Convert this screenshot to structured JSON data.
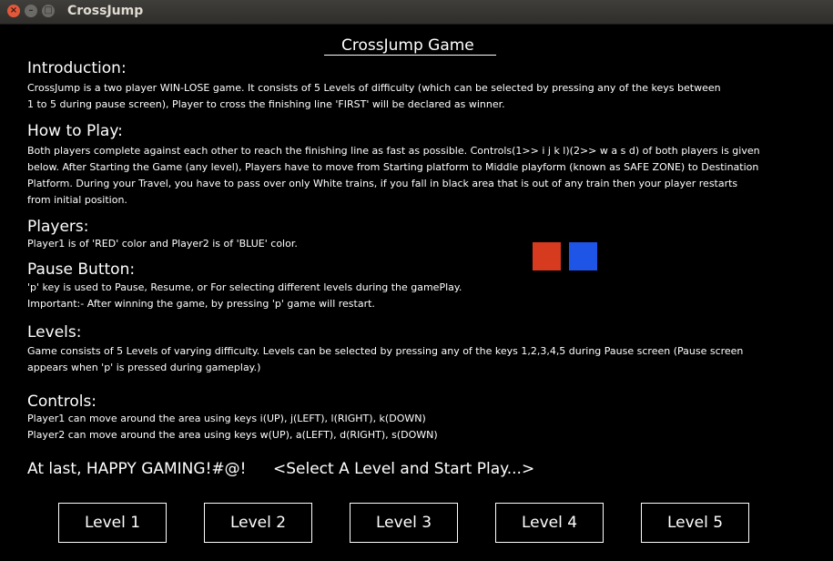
{
  "window": {
    "title": "CrossJump",
    "close_glyph": "×",
    "minimize_glyph": "–",
    "maximize_glyph": "□"
  },
  "game": {
    "title": "CrossJump Game",
    "sections": {
      "intro": {
        "heading": "Introduction:",
        "lines": [
          "CrossJump is a two player WIN-LOSE game. It consists of 5 Levels of difficulty (which can be selected by pressing any of the keys between",
          "1 to 5 during pause screen), Player to cross the finishing line 'FIRST' will be declared as winner."
        ]
      },
      "howto": {
        "heading": "How to Play:",
        "lines": [
          "Both players complete against each other to reach the finishing line as fast as possible. Controls(1>> i j k l)(2>> w a s d) of both players is given",
          "below. After Starting the Game (any level), Players have to move from Starting platform to Middle playform (known as SAFE ZONE) to Destination",
          "Platform. During your Travel, you have to pass over only White trains, if you fall in black area that is out of any train then your player restarts",
          "from initial position."
        ]
      },
      "players": {
        "heading": "Players:",
        "lines": [
          "Player1 is of 'RED' color and Player2 is of 'BLUE' color."
        ]
      },
      "pause": {
        "heading": "Pause Button:",
        "lines": [
          "'p' key is used to Pause, Resume, or For selecting different levels during the gamePlay.",
          "Important:- After winning the game, by pressing 'p' game will restart."
        ]
      },
      "levels": {
        "heading": "Levels:",
        "lines": [
          "Game consists of 5 Levels of varying difficulty. Levels can be selected by pressing any of the keys 1,2,3,4,5 during Pause screen (Pause screen",
          "appears when 'p' is pressed during gameplay.)"
        ]
      },
      "controls": {
        "heading": "Controls:",
        "lines": [
          "Player1 can move around the area using keys i(UP), j(LEFT), l(RIGHT), k(DOWN)",
          "Player2 can move around the area using keys w(UP), a(LEFT), d(RIGHT), s(DOWN)"
        ]
      }
    },
    "footer": {
      "farewell": "At last, HAPPY GAMING!#@!",
      "prompt": "<Select A Level and Start Play...>"
    },
    "level_buttons": [
      "Level 1",
      "Level 2",
      "Level 3",
      "Level 4",
      "Level 5"
    ],
    "colors": {
      "player1": "#d63a1f",
      "player2": "#1f55e6"
    }
  }
}
